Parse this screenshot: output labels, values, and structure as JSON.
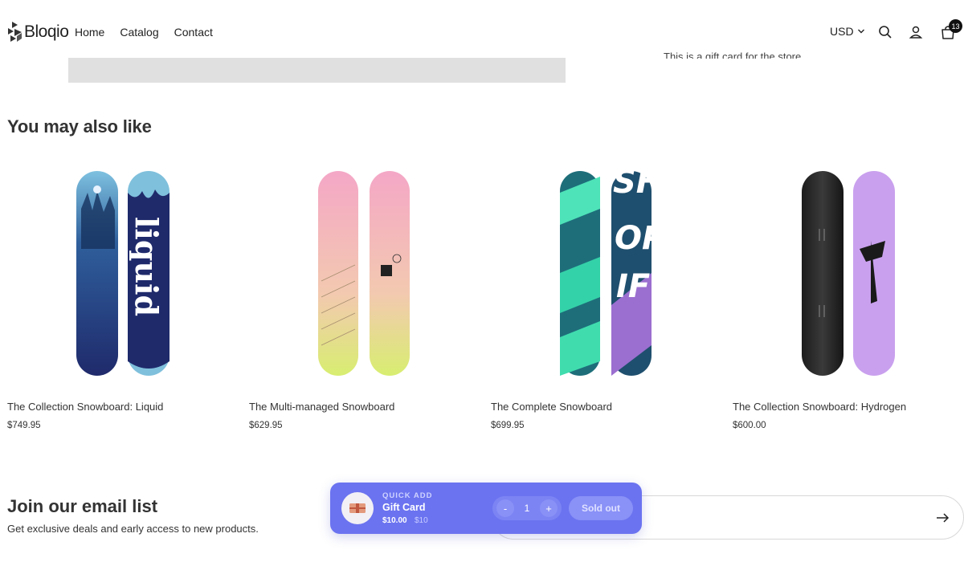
{
  "brand": {
    "name": "Bloqio"
  },
  "nav": {
    "items": [
      "Home",
      "Catalog",
      "Contact"
    ]
  },
  "header": {
    "currency": "USD",
    "cart_count": "13",
    "icons": [
      "search-icon",
      "account-icon",
      "cart-icon"
    ]
  },
  "gift_card_description": "This is a gift card for the store",
  "related": {
    "title": "You may also like",
    "products": [
      {
        "name": "The Collection Snowboard: Liquid",
        "price": "$749.95"
      },
      {
        "name": "The Multi-managed Snowboard",
        "price": "$629.95"
      },
      {
        "name": "The Complete Snowboard",
        "price": "$699.95"
      },
      {
        "name": "The Collection Snowboard: Hydrogen",
        "price": "$600.00"
      }
    ]
  },
  "newsletter": {
    "title": "Join our email list",
    "subtitle": "Get exclusive deals and early access to new products.",
    "placeholder": ""
  },
  "quick_add": {
    "label": "QUICK ADD",
    "product": "Gift Card",
    "price": "$10.00",
    "compare_price": "$10",
    "minus": "-",
    "quantity": "1",
    "plus": "+",
    "button": "Sold out"
  },
  "colors": {
    "accent": "#6b73f0",
    "text": "#2b2b2b"
  }
}
